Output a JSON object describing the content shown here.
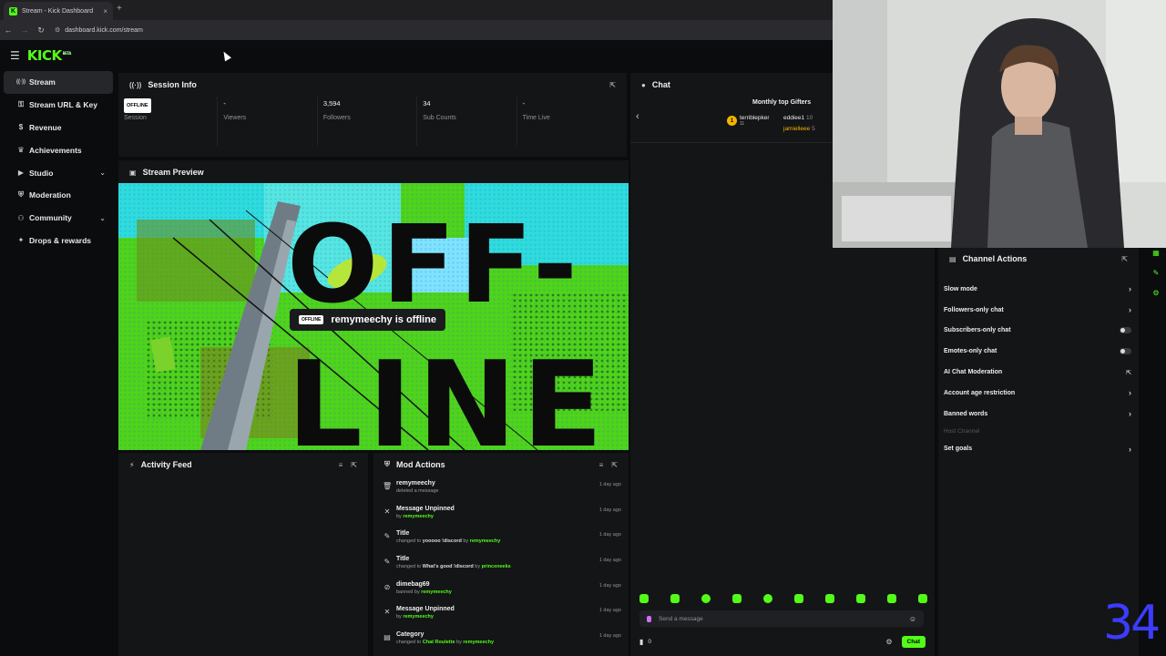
{
  "browser": {
    "tab_title": "Stream - Kick Dashboard",
    "tab_close": "×",
    "new_tab": "+",
    "url": "dashboard.kick.com/stream"
  },
  "header": {
    "logo_text": "KICK",
    "logo_sup": "BETA"
  },
  "sidebar": {
    "items": [
      {
        "label": "Stream",
        "icon": "broadcast-icon",
        "active": true
      },
      {
        "label": "Stream URL & Key",
        "icon": "key-icon"
      },
      {
        "label": "Revenue",
        "icon": "dollar-icon"
      },
      {
        "label": "Achievements",
        "icon": "trophy-icon"
      },
      {
        "label": "Studio",
        "icon": "studio-icon",
        "expandable": true
      },
      {
        "label": "Moderation",
        "icon": "shield-icon"
      },
      {
        "label": "Community",
        "icon": "people-icon",
        "expandable": true
      },
      {
        "label": "Drops & rewards",
        "icon": "gift-icon"
      }
    ]
  },
  "session_info": {
    "title": "Session Info",
    "stats": [
      {
        "value": "OFFLINE",
        "label": "Session"
      },
      {
        "value": "-",
        "label": "Viewers"
      },
      {
        "value": "3,594",
        "label": "Followers"
      },
      {
        "value": "34",
        "label": "Sub Counts"
      },
      {
        "value": "-",
        "label": "Time Live"
      }
    ]
  },
  "stream_preview": {
    "title": "Stream Preview",
    "badge": "OFFLINE",
    "message": "remymeechy is offline",
    "art_text_1": "OFF-",
    "art_text_2": "LINE"
  },
  "activity_feed": {
    "title": "Activity Feed"
  },
  "mod_actions": {
    "title": "Mod Actions",
    "items": [
      {
        "icon": "trash-icon",
        "title": "remymeechy",
        "sub_parts": [
          {
            "t": "deleted a message",
            "c": ""
          }
        ],
        "time": "1 day ago"
      },
      {
        "icon": "pin-off-icon",
        "title": "Message Unpinned",
        "sub_parts": [
          {
            "t": "by ",
            "c": ""
          },
          {
            "t": "remymeechy",
            "c": "u"
          }
        ],
        "time": "1 day ago"
      },
      {
        "icon": "pencil-icon",
        "title": "Title",
        "sub_parts": [
          {
            "t": "changed to ",
            "c": ""
          },
          {
            "t": "yooooo !discord",
            "c": "b"
          },
          {
            "t": " by ",
            "c": ""
          },
          {
            "t": "remymeechy",
            "c": "u"
          }
        ],
        "time": "1 day ago"
      },
      {
        "icon": "pencil-icon",
        "title": "Title",
        "sub_parts": [
          {
            "t": "changed to ",
            "c": ""
          },
          {
            "t": "What's good !discord",
            "c": "b"
          },
          {
            "t": " by ",
            "c": ""
          },
          {
            "t": "princeneeks",
            "c": "u"
          }
        ],
        "time": "1 day ago"
      },
      {
        "icon": "ban-icon",
        "title": "dimebag69",
        "sub_parts": [
          {
            "t": "banned by ",
            "c": ""
          },
          {
            "t": "remymeechy",
            "c": "u"
          }
        ],
        "time": "1 day ago"
      },
      {
        "icon": "pin-off-icon",
        "title": "Message Unpinned",
        "sub_parts": [
          {
            "t": "by ",
            "c": ""
          },
          {
            "t": "remymeechy",
            "c": "u"
          }
        ],
        "time": "1 day ago"
      },
      {
        "icon": "category-icon",
        "title": "Category",
        "sub_parts": [
          {
            "t": "changed to ",
            "c": ""
          },
          {
            "t": "Chat Roulette",
            "c": "u"
          },
          {
            "t": " by ",
            "c": ""
          },
          {
            "t": "remymeechy",
            "c": "u"
          }
        ],
        "time": "1 day ago"
      }
    ]
  },
  "chat": {
    "title": "Chat",
    "gifters_title": "Monthly top Gifters",
    "gifters": [
      {
        "rank": "1",
        "name": "terriblepker",
        "count": "11"
      },
      {
        "name": "eddiee1",
        "count": "10"
      },
      {
        "name": "jamielleee",
        "count": "5"
      }
    ],
    "input_placeholder": "Send a message",
    "viewer_count": "0",
    "send_label": "Chat",
    "emote_count": 10
  },
  "channel_actions": {
    "title": "Channel Actions",
    "items": [
      {
        "label": "Slow mode",
        "control": "chevron"
      },
      {
        "label": "Followers-only chat",
        "control": "chevron"
      },
      {
        "label": "Subscribers-only chat",
        "control": "toggle"
      },
      {
        "label": "Emotes-only chat",
        "control": "toggle"
      },
      {
        "label": "AI Chat Moderation",
        "control": "external"
      },
      {
        "label": "Account age restriction",
        "control": "chevron"
      },
      {
        "label": "Banned words",
        "control": "chevron"
      },
      {
        "label": "Host Channel",
        "control": "none",
        "disabled": true
      },
      {
        "label": "Set goals",
        "control": "chevron"
      }
    ]
  },
  "overlay_number": "34",
  "colors": {
    "accent": "#53fc18",
    "panel": "#141517",
    "background": "#0b0c0e",
    "overlay_blue": "#3c3cff"
  }
}
